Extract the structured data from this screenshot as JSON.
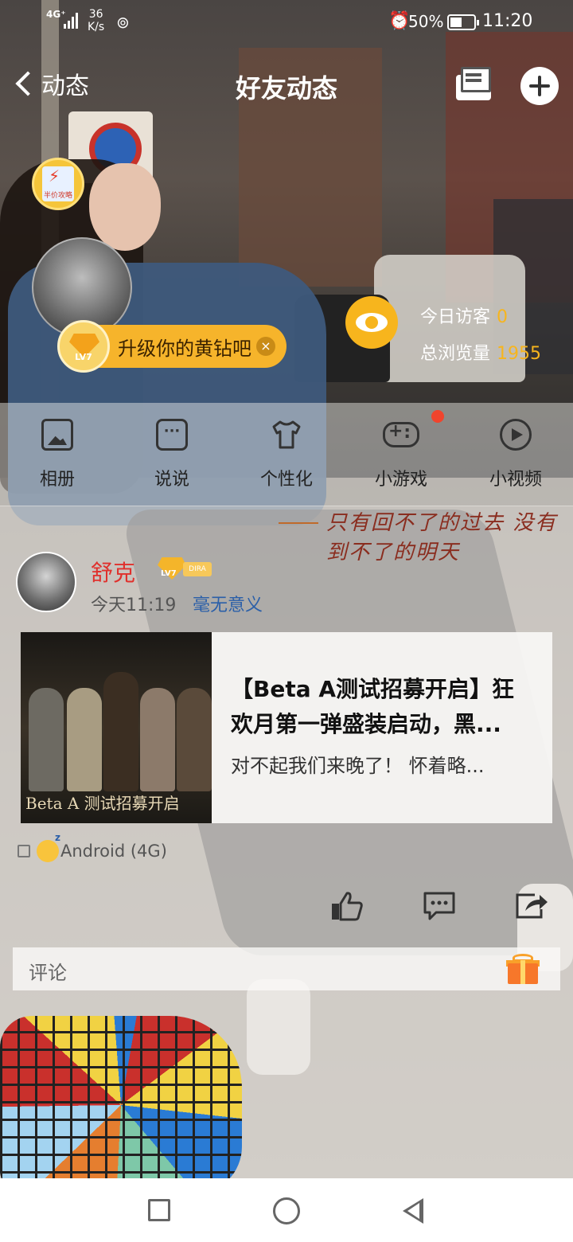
{
  "status_bar": {
    "network": "4G⁺",
    "speed_value": "36",
    "speed_unit": "K/s",
    "alarm_icon": "alarm-clock-icon",
    "battery_percent": "50%",
    "time": "11:20"
  },
  "header": {
    "back_label": "动态",
    "title": "好友动态",
    "mail_icon": "mail-icon",
    "add_icon": "plus-icon"
  },
  "profile": {
    "strategy_badge_text": "半价攻略",
    "level_badge": "LV7",
    "upgrade_text": "升级你的黄钻吧",
    "upgrade_close": "×",
    "today_visitors_label": "今日访客",
    "today_visitors_value": "0",
    "total_views_label": "总浏览量",
    "total_views_value": "1955"
  },
  "quick_menu": [
    {
      "label": "相册",
      "icon": "photo-album-icon"
    },
    {
      "label": "说说",
      "icon": "speech-bubble-icon"
    },
    {
      "label": "个性化",
      "icon": "tshirt-icon"
    },
    {
      "label": "小游戏",
      "icon": "gamepad-icon"
    },
    {
      "label": "小视频",
      "icon": "play-circle-icon"
    }
  ],
  "signature": "只有回不了的过去 没有到不了的明天",
  "post": {
    "user_name": "舒克",
    "level": "LV7",
    "badge_tag": "DIRA",
    "time": "今天11:19",
    "mood": "毫无意义",
    "share_card": {
      "thumbnail_text": "Beta A 测试招募开启",
      "title": "【Beta A测试招募开启】狂欢月第一弹盛装启动，黑...",
      "description": "对不起我们来晚了！ 怀着略..."
    },
    "device": "Android (4G)",
    "actions": {
      "like_icon": "thumbs-up-icon",
      "comment_icon": "comment-icon",
      "share_icon": "share-icon"
    },
    "comment_placeholder": "评论",
    "gift_icon": "gift-icon"
  },
  "colors": {
    "accent_yellow": "#f7b51d",
    "username_red": "#e0302c",
    "mood_blue": "#2b5fa8",
    "notification_red": "#f0442d"
  }
}
